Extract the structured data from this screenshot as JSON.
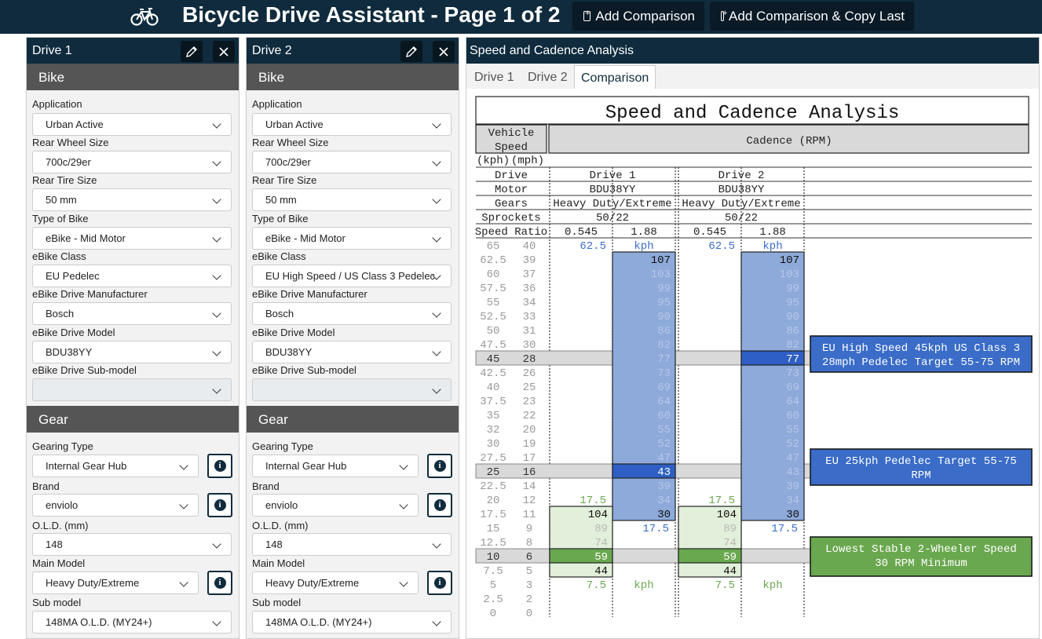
{
  "app": {
    "title": "Bicycle Drive Assistant - Page 1 of 2",
    "add_comparison": "Add Comparison",
    "add_copy": "Add Comparison & Copy Last",
    "icon": "bicycle-icon"
  },
  "drives": [
    {
      "title": "Drive 1",
      "bike_section": "Bike",
      "gear_section": "Gear",
      "application_label": "Application",
      "application": "Urban Active",
      "wheel_label": "Rear Wheel Size",
      "wheel": "700c/29er",
      "tire_label": "Rear Tire Size",
      "tire": "50 mm",
      "type_label": "Type of Bike",
      "type": "eBike - Mid Motor",
      "class_label": "eBike Class",
      "class": "EU Pedelec",
      "manu_label": "eBike Drive Manufacturer",
      "manu": "Bosch",
      "model_label": "eBike Drive Model",
      "model": "BDU38YY",
      "submodel_label": "eBike Drive Sub-model",
      "submodel": "",
      "gearing_label": "Gearing Type",
      "gearing": "Internal Gear Hub",
      "brand_label": "Brand",
      "brand": "enviolo",
      "old_label": "O.L.D. (mm)",
      "old": "148",
      "main_label": "Main Model",
      "main": "Heavy Duty/Extreme",
      "sub_label": "Sub model",
      "sub": "148MA O.L.D. (MY24+)"
    },
    {
      "title": "Drive 2",
      "bike_section": "Bike",
      "gear_section": "Gear",
      "application_label": "Application",
      "application": "Urban Active",
      "wheel_label": "Rear Wheel Size",
      "wheel": "700c/29er",
      "tire_label": "Rear Tire Size",
      "tire": "50 mm",
      "type_label": "Type of Bike",
      "type": "eBike - Mid Motor",
      "class_label": "eBike Class",
      "class": "EU High Speed / US Class 3 Pedelec",
      "manu_label": "eBike Drive Manufacturer",
      "manu": "Bosch",
      "model_label": "eBike Drive Model",
      "model": "BDU38YY",
      "submodel_label": "eBike Drive Sub-model",
      "submodel": "",
      "gearing_label": "Gearing Type",
      "gearing": "Internal Gear Hub",
      "brand_label": "Brand",
      "brand": "enviolo",
      "old_label": "O.L.D. (mm)",
      "old": "148",
      "main_label": "Main Model",
      "main": "Heavy Duty/Extreme",
      "sub_label": "Sub model",
      "sub": "148MA O.L.D. (MY24+)"
    }
  ],
  "analysis": {
    "title": "Speed and Cadence Analysis",
    "tabs": [
      "Drive 1",
      "Drive 2",
      "Comparison"
    ],
    "active_tab": "Comparison"
  },
  "chart_data": {
    "type": "table",
    "title": "Speed and Cadence Analysis",
    "vehicle_speed_header": "Vehicle Speed",
    "cadence_header": "Cadence (RPM)",
    "units": [
      "(kph)",
      "(mph)"
    ],
    "row_labels": [
      "Drive",
      "Motor",
      "Gears",
      "Sprockets",
      "Speed  Ratio"
    ],
    "drives": [
      {
        "name": "Drive 1",
        "motor": "BDU38YY",
        "gears": "Heavy Duty/Extreme",
        "sprockets": "50/22",
        "ratio_low": "0.545",
        "ratio_high": "1.88",
        "low_range": {
          "from": "7.5",
          "to": "17.5",
          "unit": "kph"
        },
        "high_range": {
          "from": "17.5",
          "to": "62.5",
          "unit": "kph"
        },
        "low_values": [
          "104",
          "89",
          "74",
          "59",
          "44"
        ],
        "high_values": [
          "107",
          "103",
          "99",
          "95",
          "90",
          "86",
          "82",
          "77",
          "73",
          "69",
          "64",
          "60",
          "55",
          "52",
          "47",
          "43",
          "39",
          "34",
          "30"
        ]
      },
      {
        "name": "Drive 2",
        "motor": "BDU38YY",
        "gears": "Heavy Duty/Extreme",
        "sprockets": "50/22",
        "ratio_low": "0.545",
        "ratio_high": "1.88",
        "low_range": {
          "from": "7.5",
          "to": "17.5",
          "unit": "kph"
        },
        "high_range": {
          "from": "17.5",
          "to": "62.5",
          "unit": "kph"
        },
        "low_values": [
          "104",
          "89",
          "74",
          "59",
          "44"
        ],
        "high_values": [
          "107",
          "103",
          "99",
          "95",
          "90",
          "86",
          "82",
          "77",
          "73",
          "69",
          "64",
          "60",
          "55",
          "52",
          "47",
          "43",
          "39",
          "34",
          "30"
        ]
      }
    ],
    "speeds_kph": [
      "65",
      "62.5",
      "60",
      "57.5",
      "55",
      "52.5",
      "50",
      "47.5",
      "45",
      "42.5",
      "40",
      "37.5",
      "35",
      "32",
      "30",
      "27.5",
      "25",
      "22.5",
      "20",
      "17.5",
      "15",
      "12.5",
      "10",
      "7.5",
      "5",
      "2.5",
      "0"
    ],
    "speeds_mph": [
      "40",
      "39",
      "37",
      "36",
      "34",
      "33",
      "31",
      "30",
      "28",
      "26",
      "25",
      "23",
      "22",
      "20",
      "19",
      "17",
      "16",
      "14",
      "12",
      "11",
      "9",
      "8",
      "6",
      "5",
      "3",
      "2",
      "0"
    ],
    "highlight_speeds_kph": [
      "45",
      "25",
      "10"
    ],
    "annotations": [
      {
        "line1": "EU High Speed 45kph US Class 3",
        "line2": "28mph Pedelec Target 55-75 RPM",
        "color": "#3a6cc8"
      },
      {
        "line1": "EU 25kph Pedelec Target 55-75",
        "line2": "RPM",
        "color": "#3a6cc8"
      },
      {
        "line1": "Lowest Stable 2-Wheeler Speed",
        "line2": "30 RPM Minimum",
        "color": "#6aa84f"
      }
    ]
  }
}
